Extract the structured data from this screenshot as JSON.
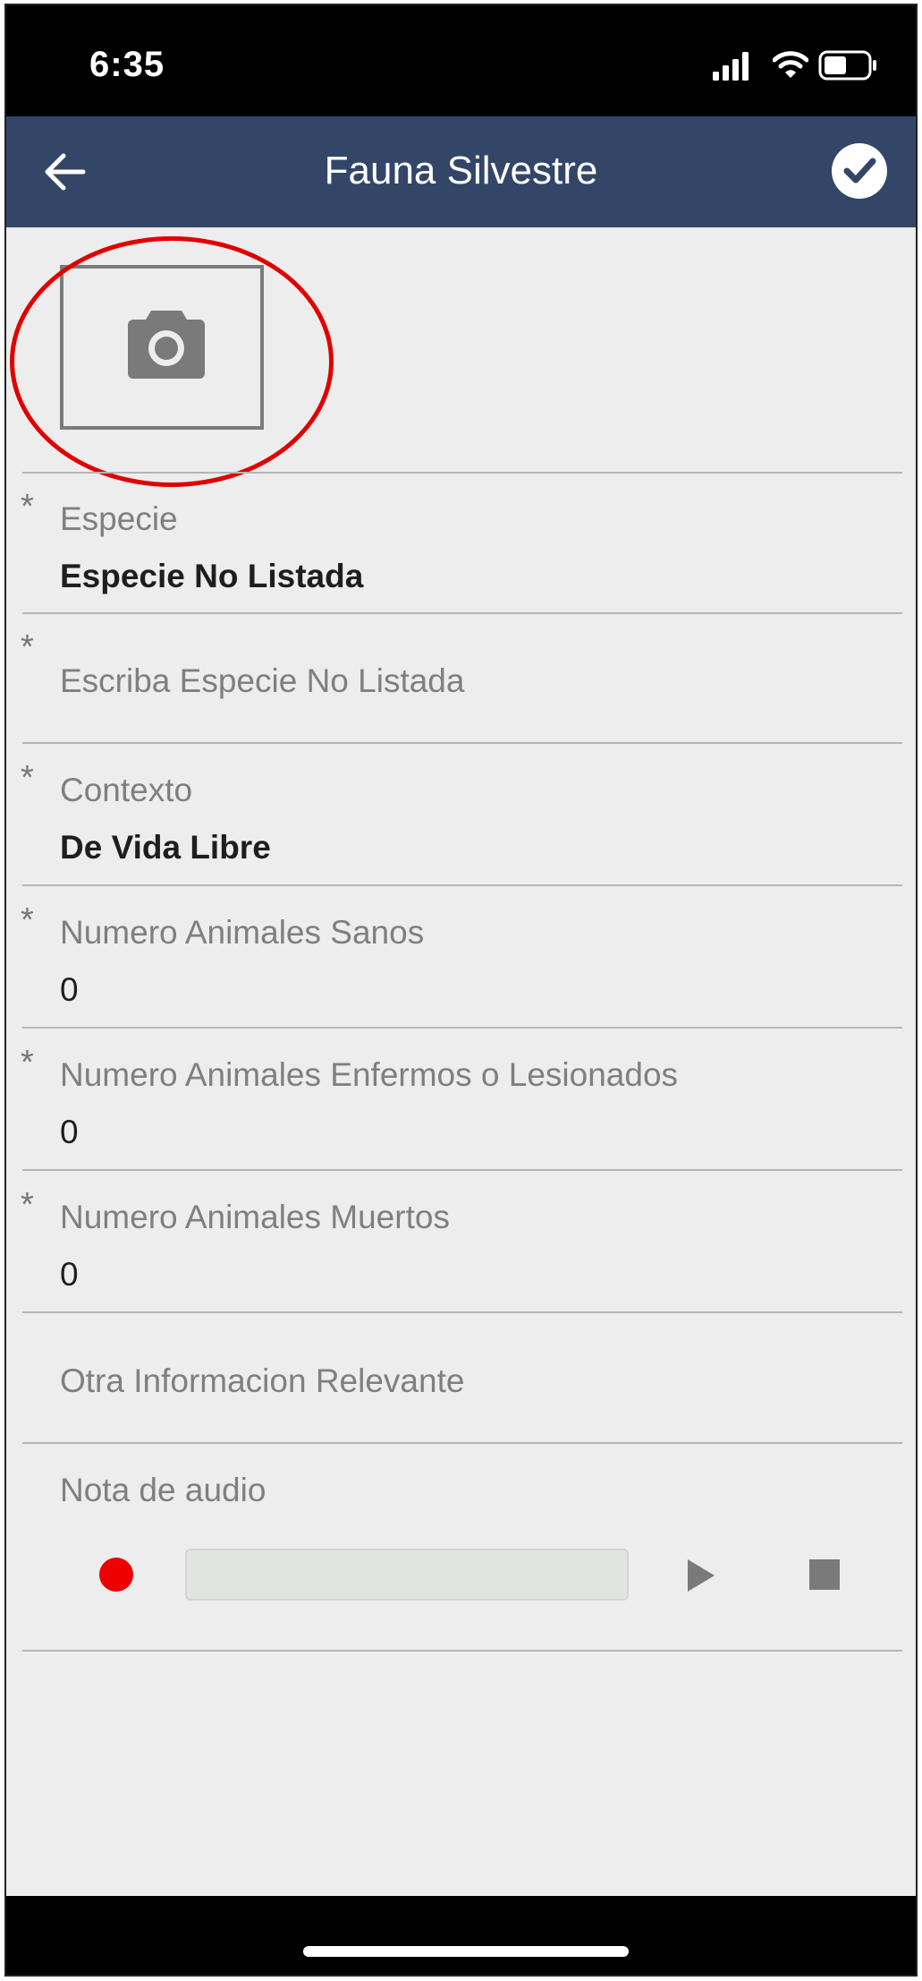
{
  "status_bar": {
    "time": "6:35"
  },
  "header": {
    "title": "Fauna Silvestre",
    "back_icon": "arrow-left-icon",
    "confirm_icon": "check-circle-icon"
  },
  "photo": {
    "icon": "camera-icon"
  },
  "fields": {
    "especie": {
      "label": "Especie",
      "value": "Especie No Listada",
      "required": "*"
    },
    "especie_no_listada": {
      "placeholder": "Escriba Especie No Listada",
      "required": "*"
    },
    "contexto": {
      "label": "Contexto",
      "value": "De Vida Libre",
      "required": "*"
    },
    "sanos": {
      "label": "Numero Animales Sanos",
      "value": "0",
      "required": "*"
    },
    "enfermos": {
      "label": "Numero Animales Enfermos o Lesionados",
      "value": "0",
      "required": "*"
    },
    "muertos": {
      "label": "Numero Animales Muertos",
      "value": "0",
      "required": "*"
    },
    "otra_info": {
      "placeholder": "Otra Informacion Relevante"
    }
  },
  "audio": {
    "label": "Nota de audio"
  },
  "colors": {
    "header_bg": "#334668",
    "record": "#ee0000",
    "highlight": "#e00000"
  }
}
